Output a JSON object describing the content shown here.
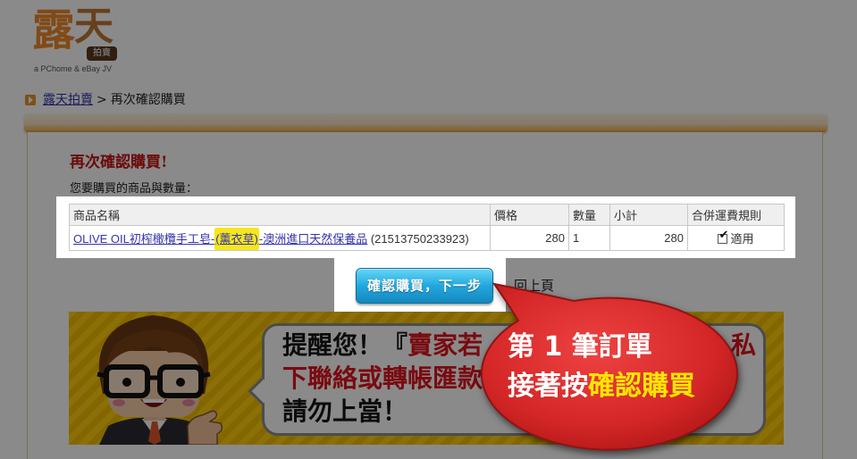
{
  "logo": {
    "char_1": "露",
    "char_2": "天",
    "badge": "拍賣",
    "tagline": "a PChome & eBay JV"
  },
  "breadcrumb": {
    "home": "露天拍賣",
    "separator": ">",
    "current": "再次確認購買"
  },
  "page": {
    "title": "再次確認購買!",
    "subtitle": "您要購買的商品與數量："
  },
  "table": {
    "headers": [
      "商品名稱",
      "價格",
      "數量",
      "小計",
      "合併運費規則"
    ],
    "rows": [
      {
        "name_prefix": "OLIVE OIL初榨橄欖手工皂-",
        "name_highlight": "(薰衣草)",
        "name_suffix": "-澳洲進口天然保養品",
        "item_id": "(21513750233923)",
        "price": "280",
        "quantity": "1",
        "subtotal": "280",
        "shipping_rule": "適用",
        "shipping_rule_checked": true
      }
    ]
  },
  "actions": {
    "confirm": "確認購買，下一步",
    "back": "回上頁"
  },
  "banner": {
    "line_1_black": "提醒您！『",
    "line_1_red": "賣家若",
    "line_1_end": "私",
    "line_2": "下聯絡或轉帳匯款",
    "line_3": "請勿上當！"
  },
  "callout": {
    "line_1": "第 1 筆訂單",
    "line_2_prefix": "接著按",
    "line_2_highlight": "確認購買"
  },
  "icons": {
    "breadcrumb": "arrow-right-icon",
    "shipping_rule": "checkbox-checked-icon"
  },
  "colors": {
    "link": "#3434ae",
    "title_red": "#c41616",
    "warning_red": "#e0141e",
    "callout_red": "#d42626",
    "callout_highlight": "#ffe600",
    "confirm_button": "#22a8de",
    "text_highlight": "#f6e61c",
    "banner_yellow": "#ffcf0d",
    "dim_overlay": "rgba(0,0,0,0.46)"
  }
}
